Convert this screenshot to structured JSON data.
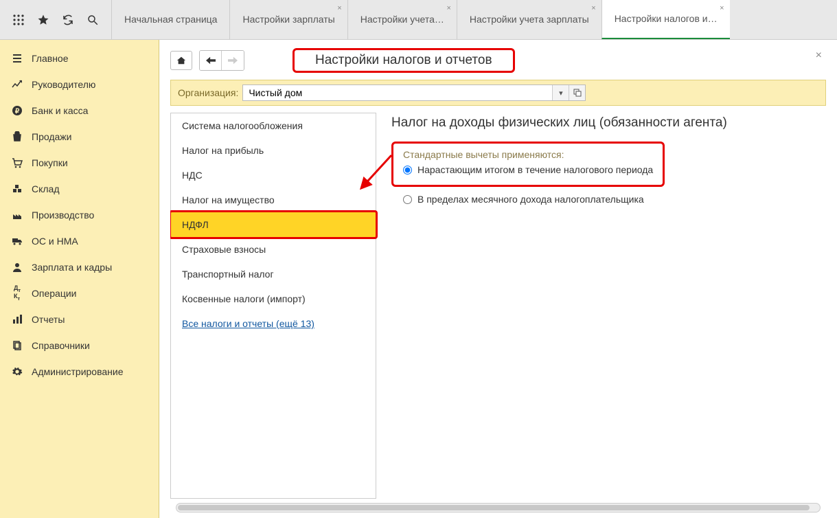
{
  "tabs": [
    {
      "label": "Начальная страница",
      "closable": false
    },
    {
      "label": "Настройки зарплаты",
      "closable": true
    },
    {
      "label": "Настройки учета…",
      "closable": true
    },
    {
      "label": "Настройки учета зарплаты",
      "closable": true
    },
    {
      "label": "Настройки налогов и…",
      "closable": true,
      "active": true
    }
  ],
  "sidebar": {
    "items": [
      {
        "label": "Главное",
        "icon": "menu"
      },
      {
        "label": "Руководителю",
        "icon": "chart"
      },
      {
        "label": "Банк и касса",
        "icon": "ruble"
      },
      {
        "label": "Продажи",
        "icon": "bag"
      },
      {
        "label": "Покупки",
        "icon": "cart"
      },
      {
        "label": "Склад",
        "icon": "boxes"
      },
      {
        "label": "Производство",
        "icon": "factory"
      },
      {
        "label": "ОС и НМА",
        "icon": "truck"
      },
      {
        "label": "Зарплата и кадры",
        "icon": "person"
      },
      {
        "label": "Операции",
        "icon": "dk"
      },
      {
        "label": "Отчеты",
        "icon": "bars"
      },
      {
        "label": "Справочники",
        "icon": "docs"
      },
      {
        "label": "Администрирование",
        "icon": "gear"
      }
    ]
  },
  "page": {
    "title": "Настройки налогов и отчетов",
    "org_label": "Организация:",
    "org_value": "Чистый дом"
  },
  "tax_list": {
    "items": [
      "Система налогообложения",
      "Налог на прибыль",
      "НДС",
      "Налог на имущество",
      "НДФЛ",
      "Страховые взносы",
      "Транспортный налог",
      "Косвенные налоги (импорт)"
    ],
    "selected_index": 4,
    "more_link": "Все налоги и отчеты (ещё 13)"
  },
  "detail": {
    "title": "Налог на доходы физических лиц (обязанности агента)",
    "group_label": "Стандартные вычеты применяются:",
    "radio1": "Нарастающим итогом в течение налогового периода",
    "radio2": "В пределах месячного дохода налогоплательщика"
  }
}
